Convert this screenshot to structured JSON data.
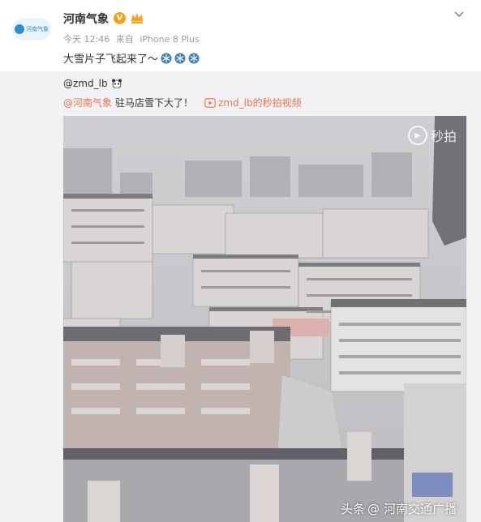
{
  "post": {
    "avatar_text": "河南气象",
    "username": "河南气象",
    "verified_badge": "V",
    "time": "今天 12:46",
    "device_prefix": "来自",
    "device": "iPhone 8 Plus",
    "text": "大雪片子飞起来了～",
    "icons": [
      "snowflake-icon",
      "snowflake-icon",
      "snowflake-icon"
    ]
  },
  "repost": {
    "user": "@zmd_lb",
    "mention": "@河南气象",
    "text": "驻马店雪下大了！",
    "video_link": "zmd_lb的秒拍视频"
  },
  "video": {
    "watermark": "秒拍"
  },
  "credit": {
    "platform": "头条",
    "source": "河南交通广播"
  },
  "colors": {
    "accent": "#eb7350",
    "verified": "#f7a21b",
    "repost_bg": "#f2f2f5"
  }
}
